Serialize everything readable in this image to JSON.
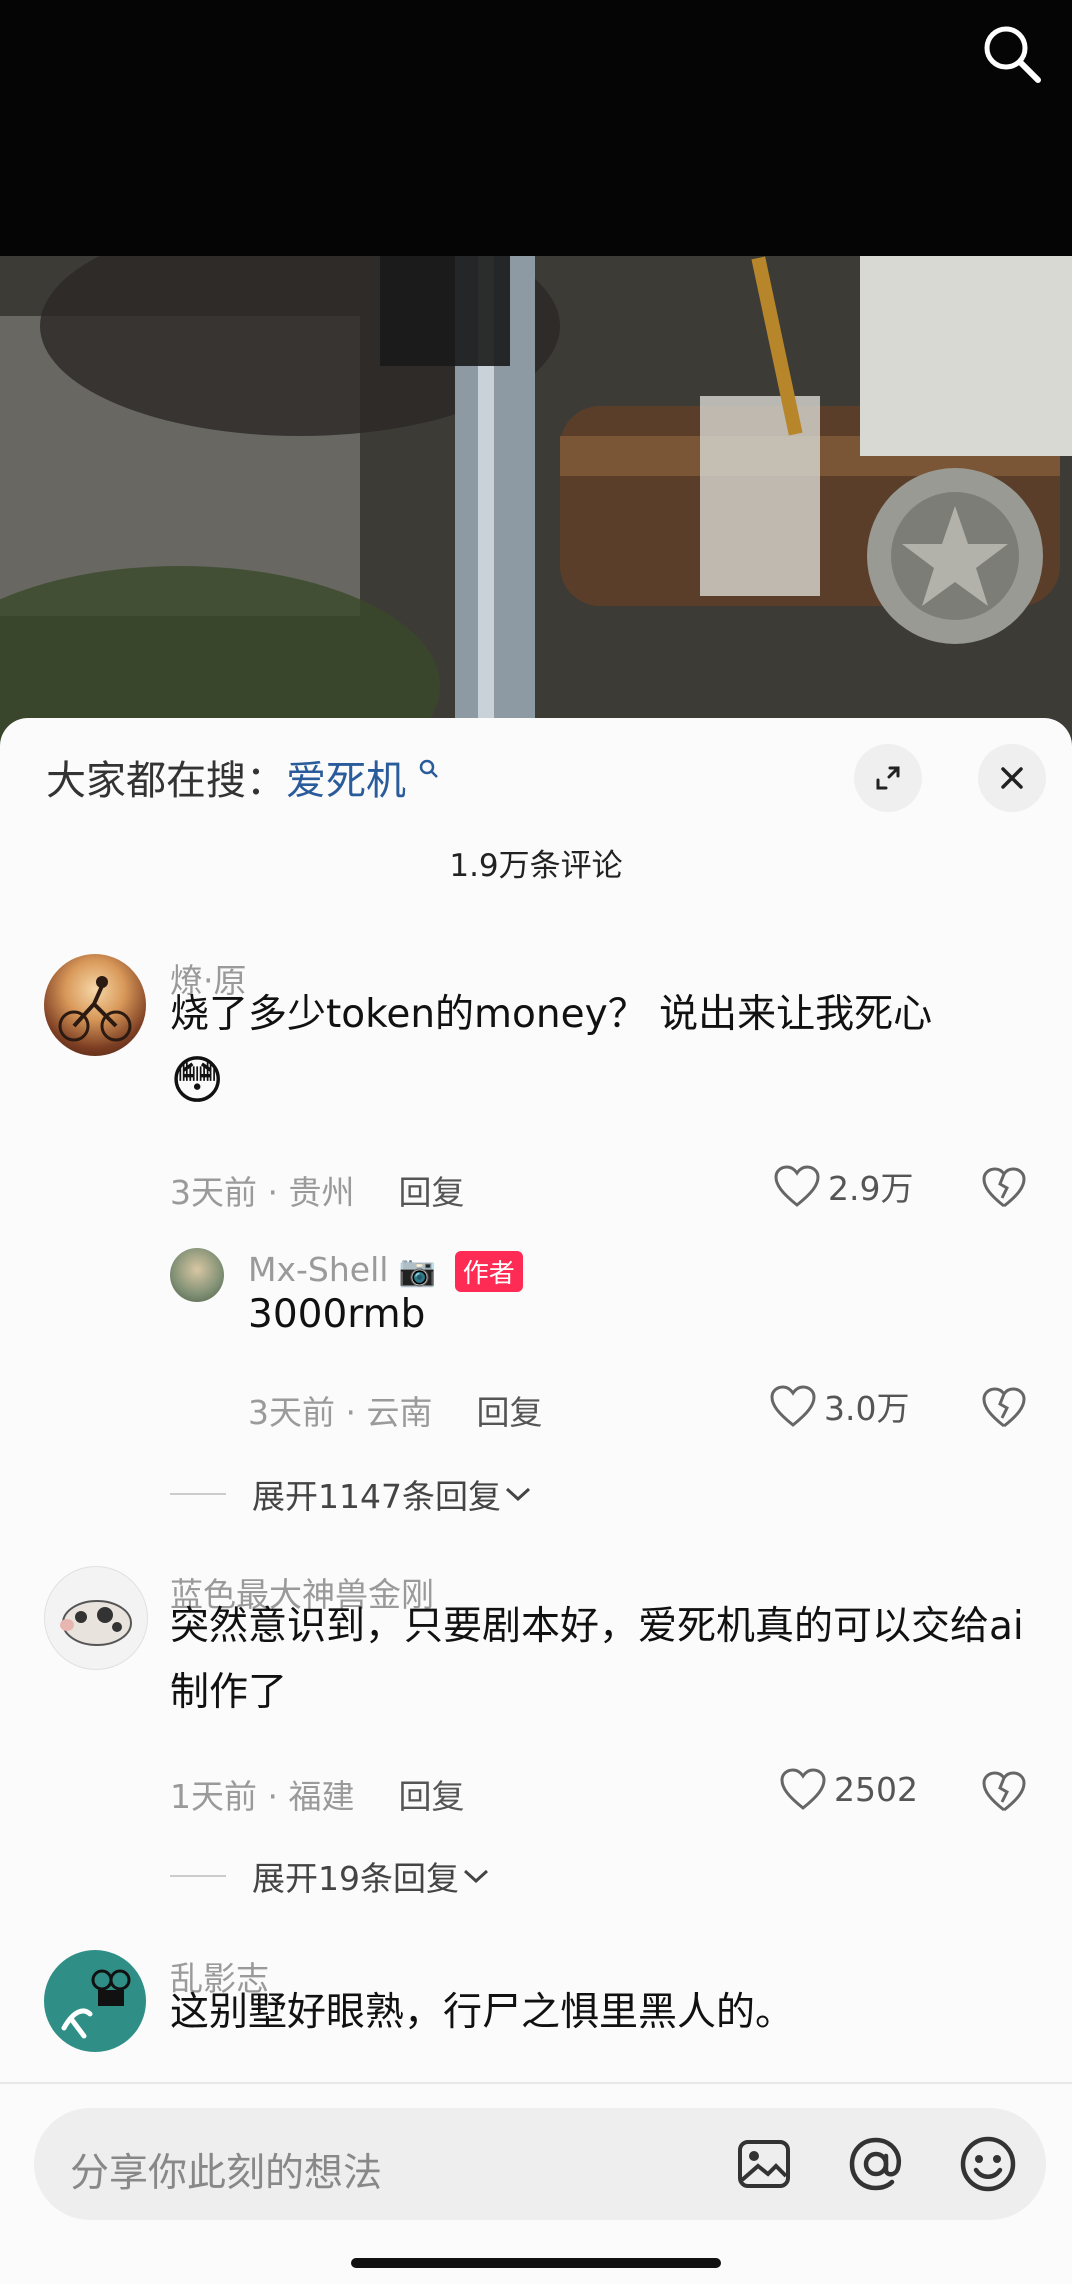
{
  "header": {
    "search_icon": "search-icon"
  },
  "trending": {
    "label": "大家都在搜：",
    "keyword": "爱死机"
  },
  "comment_count": "1.9万条评论",
  "comments": [
    {
      "user": "燎·原",
      "text": "烧了多少token的money？ 说出来让我死心",
      "emoji": "😳",
      "time": "3天前",
      "location": "贵州",
      "reply": "回复",
      "likes": "2.9万"
    },
    {
      "user": "Mx-Shell",
      "camera": "📷",
      "badge": "作者",
      "text": "3000rmb",
      "time": "3天前",
      "location": "云南",
      "reply": "回复",
      "likes": "3.0万"
    },
    {
      "expand": "展开1147条回复"
    },
    {
      "user": "蓝色最大神兽金刚",
      "text": "突然意识到，只要剧本好，爱死机真的可以交给ai制作了",
      "time": "1天前",
      "location": "福建",
      "reply": "回复",
      "likes": "2502"
    },
    {
      "expand": "展开19条回复"
    },
    {
      "user": "乱影志",
      "text": "这别墅好眼熟，行尸之惧里黑人的。"
    }
  ],
  "input": {
    "placeholder": "分享你此刻的想法"
  },
  "colors": {
    "accent": "#fe2c55",
    "link": "#2a5b9a"
  }
}
